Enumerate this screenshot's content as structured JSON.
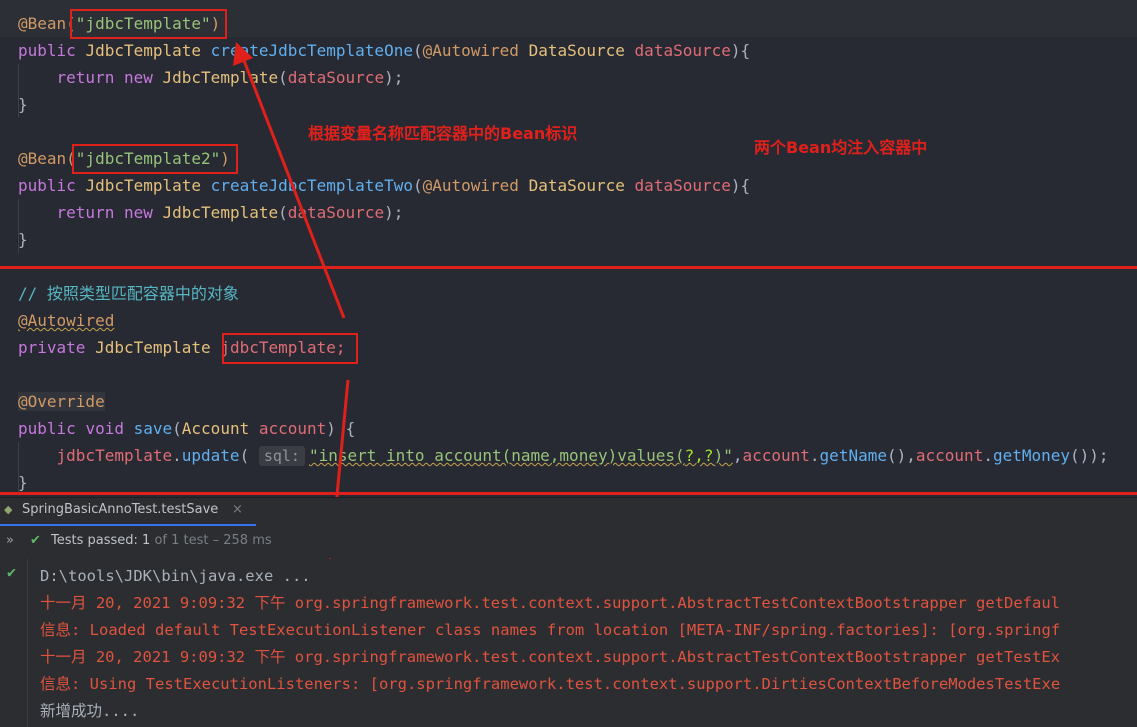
{
  "code": {
    "bean1_prefix": "@Bean(",
    "bean1_name": "\"jdbcTemplate\"",
    "bean1_suffix": ")",
    "m1_public": "public",
    "m1_type": "JdbcTemplate",
    "m1_name": "createJdbcTemplateOne",
    "m1_open": "(",
    "m1_ann": "@Autowired",
    "m1_ptype": "DataSource",
    "m1_pname": "dataSource",
    "m1_close": "){",
    "r1_return": "return",
    "r1_new": "new",
    "r1_type": "JdbcTemplate",
    "r1_open": "(",
    "r1_arg": "dataSource",
    "r1_close": ");",
    "close1": "}",
    "bean2_prefix": "@Bean(",
    "bean2_name": "\"jdbcTemplate2\"",
    "bean2_suffix": ")",
    "m2_public": "public",
    "m2_type": "JdbcTemplate",
    "m2_name": "createJdbcTemplateTwo",
    "m2_open": "(",
    "m2_ann": "@Autowired",
    "m2_ptype": "DataSource",
    "m2_pname": "dataSource",
    "m2_close": "){",
    "r2_return": "return",
    "r2_new": "new",
    "r2_type": "JdbcTemplate",
    "r2_open": "(",
    "r2_arg": "dataSource",
    "r2_close": ");",
    "close2": "}",
    "comment": "// 按照类型匹配容器中的对象",
    "autowired": "@Autowired",
    "field_private": "private",
    "field_type": "JdbcTemplate",
    "field_name": "jdbcTemplate;",
    "override": "@Override",
    "save_public": "public",
    "save_void": "void",
    "save_name": "save",
    "save_open": "(",
    "save_ptype": "Account",
    "save_pname": "account",
    "save_close": ") {",
    "upd_obj": "jdbcTemplate",
    "upd_dot": ".",
    "upd_method": "update",
    "upd_open": "(",
    "upd_hint": "sql:",
    "upd_sql_a": "\"insert into account(name,money)values(",
    "upd_sql_b": "?,?",
    "upd_sql_c": ")\"",
    "upd_comma1": ",",
    "upd_acc1": "account",
    "upd_dot2": ".",
    "upd_getname": "getName",
    "upd_mid": "(),",
    "upd_acc2": "account",
    "upd_dot3": ".",
    "upd_getmoney": "getMoney",
    "upd_end": "());",
    "close3": "}"
  },
  "annotations": {
    "match_by_name": "根据变量名称匹配容器中的Bean标识",
    "both_beans": "两个Bean均注入容器中"
  },
  "run_tab": {
    "label": "SpringBasicAnnoTest.testSave",
    "close": "×"
  },
  "test_status": {
    "prefix": "Tests passed: ",
    "passed": "1",
    "of_text": " of 1 test – 258 ms"
  },
  "console": {
    "lines": [
      "D:\\tools\\JDK\\bin\\java.exe ...",
      "十一月 20, 2021 9:09:32 下午 org.springframework.test.context.support.AbstractTestContextBootstrapper getDefaul",
      "信息: Loaded default TestExecutionListener class names from location [META-INF/spring.factories]: [org.springf",
      "十一月 20, 2021 9:09:32 下午 org.springframework.test.context.support.AbstractTestContextBootstrapper getTestEx",
      "信息: Using TestExecutionListeners: [org.springframework.test.context.support.DirtiesContextBeforeModesTestExe",
      "新增成功...."
    ]
  },
  "colors": {
    "editor_bg": "#272a33",
    "panel_bg": "#2b2d30",
    "annotation_red": "#e0201b",
    "console_error": "#e0533f",
    "pass_green": "#5fb865",
    "tab_accent": "#3574f0"
  },
  "icons": {
    "tab_icon": "run-test-icon",
    "check": "checkmark-icon",
    "expand": "double-chevron-icon"
  }
}
